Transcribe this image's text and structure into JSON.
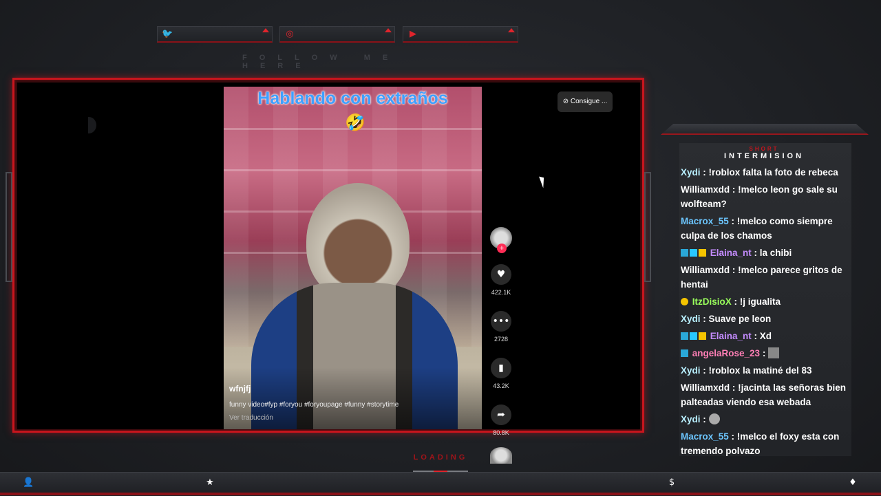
{
  "social": [
    {
      "icon": "twitter-icon"
    },
    {
      "icon": "instagram-icon"
    },
    {
      "icon": "youtube-icon"
    }
  ],
  "follow_text": "FOLLOW ME HERE",
  "video": {
    "title": "Hablando con extraños",
    "username": "wfnjfj",
    "caption": "funny video#fyp #foryou #foryoupage #funny #storytime",
    "translate": "Ver traducción",
    "likes": "422.1K",
    "comments": "2728",
    "saves": "43.2K",
    "shares": "80.8K",
    "consigue": "Consigue ..."
  },
  "chat": {
    "header_small": "SHORT",
    "header": "INTERMISION",
    "messages": [
      {
        "user": "Xydi",
        "text": " : !roblox falta la foto de rebeca",
        "color": "#b9f0ff"
      },
      {
        "user": "Williamxdd",
        "text": " : !melco leon go sale su wolfteam?",
        "color": "#ffffff"
      },
      {
        "user": "Macrox_55",
        "text": " : !melco como siempre culpa de los chamos",
        "color": "#6cc6ff"
      },
      {
        "user": "Elaina_nt",
        "text": " : la chibi",
        "color": "#c58cff"
      },
      {
        "user": "Williamxdd",
        "text": " : !melco parece gritos de hentai",
        "color": "#ffffff"
      },
      {
        "user": "ItzDisioX",
        "text": " : !j igualita",
        "color": "#9aff5c"
      },
      {
        "user": "Xydi",
        "text": " : Suave pe leon",
        "color": "#b9f0ff"
      },
      {
        "user": "Elaina_nt",
        "text": " : Xd",
        "color": "#c58cff"
      },
      {
        "user": "angelaRose_23",
        "text": " :",
        "color": "#ff7fb6"
      },
      {
        "user": "Xydi",
        "text": " : !roblox la matiné del 83",
        "color": "#b9f0ff"
      },
      {
        "user": "Williamxdd",
        "text": " : !jacinta las señoras bien palteadas viendo esa webada",
        "color": "#ffffff"
      },
      {
        "user": "Xydi",
        "text": " :",
        "color": "#b9f0ff"
      },
      {
        "user": "Macrox_55",
        "text": " : !melco el foxy esta con tremendo polvazo",
        "color": "#6cc6ff"
      }
    ]
  },
  "loading": "LOADING",
  "bottom_icons": [
    "user-icon",
    "star-icon",
    "dollar-icon",
    "diamond-icon"
  ]
}
